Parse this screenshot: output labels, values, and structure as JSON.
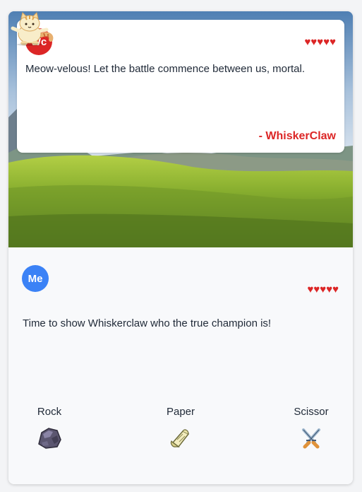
{
  "opponent": {
    "avatar_initials": "Wc",
    "avatar_color": "#dc2626",
    "hearts": "♥♥♥♥♥",
    "hearts_color": "#dc2626",
    "message": "Meow-velous! Let the battle commence between us, mortal.",
    "signature": "- WhiskerClaw",
    "signature_color": "#dc2626",
    "sprite": "cat-sprite"
  },
  "player": {
    "avatar_initials": "Me",
    "avatar_color": "#3b82f6",
    "hearts": "♥♥♥♥♥",
    "hearts_color": "#dc2626",
    "message": "Time to show Whiskerclaw who the true champion is!"
  },
  "choices": [
    {
      "label": "Rock",
      "icon": "rock-icon"
    },
    {
      "label": "Paper",
      "icon": "paper-icon"
    },
    {
      "label": "Scissor",
      "icon": "scissor-icon"
    }
  ]
}
